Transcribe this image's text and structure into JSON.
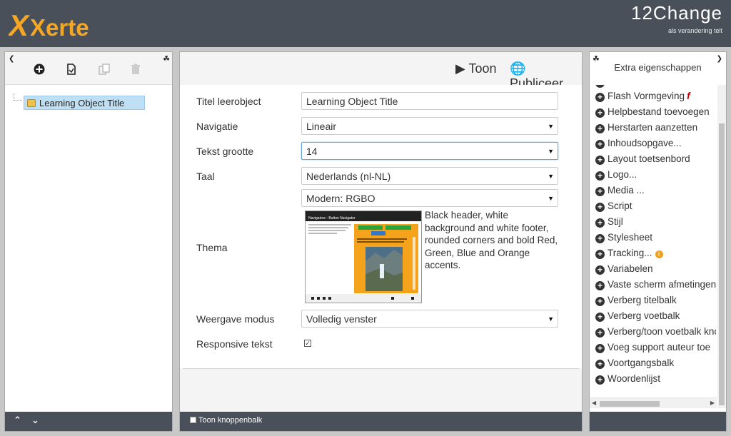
{
  "header": {
    "logo": "Xerte",
    "brand_name": "12Change",
    "brand_tagline": "als verandering telt"
  },
  "left_panel": {
    "collapse_icon": "chevron-left-icon",
    "pin_icon": "pin-icon",
    "tools": [
      "add-icon",
      "new-page-icon",
      "duplicate-icon",
      "delete-icon"
    ],
    "tree_root_label": "Learning Object Title",
    "footer": {
      "up_icon": "chevron-up-icon",
      "down_icon": "chevron-down-icon"
    }
  },
  "center_panel": {
    "toon_label": "Toon",
    "publish_label": "Publiceer",
    "fields": {
      "title_label": "Titel leerobject",
      "title_value": "Learning Object Title",
      "navigation_label": "Navigatie",
      "navigation_value": "Lineair",
      "textsize_label": "Tekst grootte",
      "textsize_value": "14",
      "language_label": "Taal",
      "language_value": "Nederlands (nl-NL)",
      "theme_label": "Thema",
      "theme_value": "Modern: RGBO",
      "theme_description": "Black header, white background and white footer, rounded corners and bold Red, Green, Blue and Orange accents.",
      "theme_preview_title": "Navigators - Button Navigator",
      "display_label": "Weergave modus",
      "display_value": "Volledig venster",
      "responsive_label": "Responsive tekst",
      "responsive_checked": true
    },
    "footer_checkbox_label": "Toon knoppenbalk"
  },
  "right_panel": {
    "title": "Extra eigenschappen",
    "items": [
      "Flash Vormgeving",
      "Helpbestand toevoegen",
      "Herstarten aanzetten",
      "Inhoudsopgave...",
      "Layout toetsenbord",
      "Logo...",
      "Media ...",
      "Script",
      "Stijl",
      "Stylesheet",
      "Tracking...",
      "Variabelen",
      "Vaste scherm afmetingen",
      "Verberg titelbalk",
      "Verberg voetbalk",
      "Verberg/toon voetbalk knoppen",
      "Voeg support auteur toe",
      "Voortgangsbalk",
      "Woordenlijst"
    ]
  },
  "colors": {
    "header_bg": "#4a5059",
    "logo_orange": "#f39c12",
    "selection": "#bfe0f4"
  }
}
